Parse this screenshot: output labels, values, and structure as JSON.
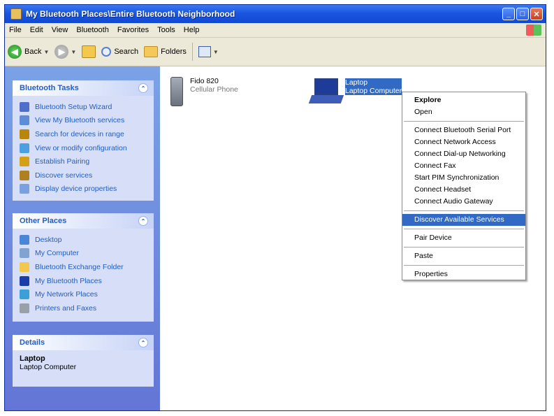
{
  "window": {
    "title": "My Bluetooth Places\\Entire Bluetooth Neighborhood",
    "min_label": "_",
    "max_label": "□",
    "close_label": "✕"
  },
  "menubar": {
    "items": [
      "File",
      "Edit",
      "View",
      "Bluetooth",
      "Favorites",
      "Tools",
      "Help"
    ]
  },
  "toolbar": {
    "back_label": "Back",
    "search_label": "Search",
    "folders_label": "Folders"
  },
  "bluetooth_tasks": {
    "title": "Bluetooth Tasks",
    "collapse_glyph": "⌃",
    "items": [
      {
        "label": "Bluetooth Setup Wizard",
        "icon": "wizard-icon"
      },
      {
        "label": "View My Bluetooth services",
        "icon": "view-services-icon"
      },
      {
        "label": "Search for devices in range",
        "icon": "search-devices-icon"
      },
      {
        "label": "View or modify configuration",
        "icon": "configuration-icon"
      },
      {
        "label": "Establish Pairing",
        "icon": "pairing-icon"
      },
      {
        "label": "Discover services",
        "icon": "discover-icon"
      },
      {
        "label": "Display device properties",
        "icon": "properties-icon"
      }
    ]
  },
  "other_places": {
    "title": "Other Places",
    "collapse_glyph": "⌃",
    "items": [
      {
        "label": "Desktop",
        "icon": "desktop-icon"
      },
      {
        "label": "My Computer",
        "icon": "computer-icon"
      },
      {
        "label": "Bluetooth Exchange Folder",
        "icon": "folder-icon"
      },
      {
        "label": "My Bluetooth Places",
        "icon": "bluetooth-icon"
      },
      {
        "label": "My Network Places",
        "icon": "network-icon"
      },
      {
        "label": "Printers and Faxes",
        "icon": "printer-icon"
      }
    ]
  },
  "details": {
    "title": "Details",
    "collapse_glyph": "⌃",
    "name": "Laptop",
    "type": "Laptop Computer"
  },
  "devices": [
    {
      "name": "Fido 820",
      "type": "Cellular Phone",
      "icon": "phone-icon"
    },
    {
      "name": "Laptop",
      "type": "Laptop Computer",
      "icon": "laptop-icon"
    }
  ],
  "context_menu": {
    "items": [
      {
        "label": "Explore",
        "bold": true
      },
      {
        "label": "Open"
      },
      {
        "separator": true
      },
      {
        "label": "Connect Bluetooth Serial Port"
      },
      {
        "label": "Connect Network Access"
      },
      {
        "label": "Connect Dial-up Networking"
      },
      {
        "label": "Connect Fax"
      },
      {
        "label": "Start PIM Synchronization"
      },
      {
        "label": "Connect Headset"
      },
      {
        "label": "Connect Audio Gateway"
      },
      {
        "separator": true
      },
      {
        "label": "Discover Available Services",
        "highlighted": true
      },
      {
        "separator": true
      },
      {
        "label": "Pair Device"
      },
      {
        "separator": true
      },
      {
        "label": "Paste"
      },
      {
        "separator": true
      },
      {
        "label": "Properties"
      }
    ]
  },
  "colors": {
    "title_bar": "#1a56e0",
    "task_pane_bg": "#6f8fe0",
    "task_link": "#215dc6",
    "selection": "#316ac5"
  }
}
